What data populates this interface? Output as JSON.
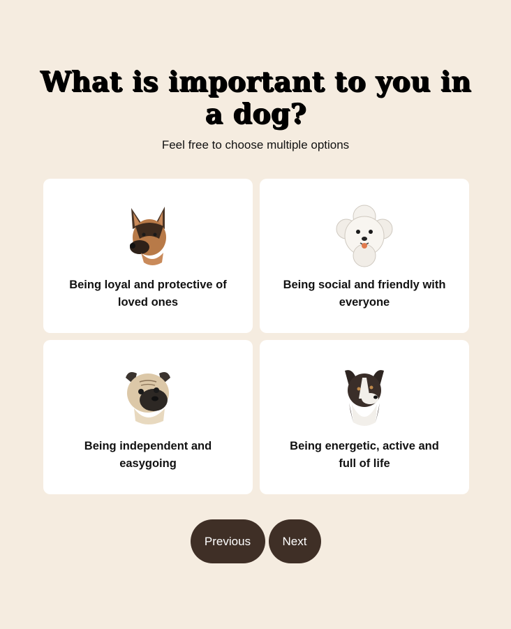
{
  "question": {
    "title": "What is important to you in a dog?",
    "subtitle": "Feel free to choose multiple options"
  },
  "options": [
    {
      "label": "Being loyal and protective of loved ones",
      "icon": "german-shepherd-icon"
    },
    {
      "label": "Being social and friendly with everyone",
      "icon": "bichon-frise-icon"
    },
    {
      "label": "Being independent and easygoing",
      "icon": "pug-icon"
    },
    {
      "label": "Being energetic, active and full of life",
      "icon": "border-collie-icon"
    }
  ],
  "nav": {
    "previous_label": "Previous",
    "next_label": "Next"
  },
  "colors": {
    "background": "#f5ece0",
    "card": "#ffffff",
    "button": "#3f2f26"
  }
}
